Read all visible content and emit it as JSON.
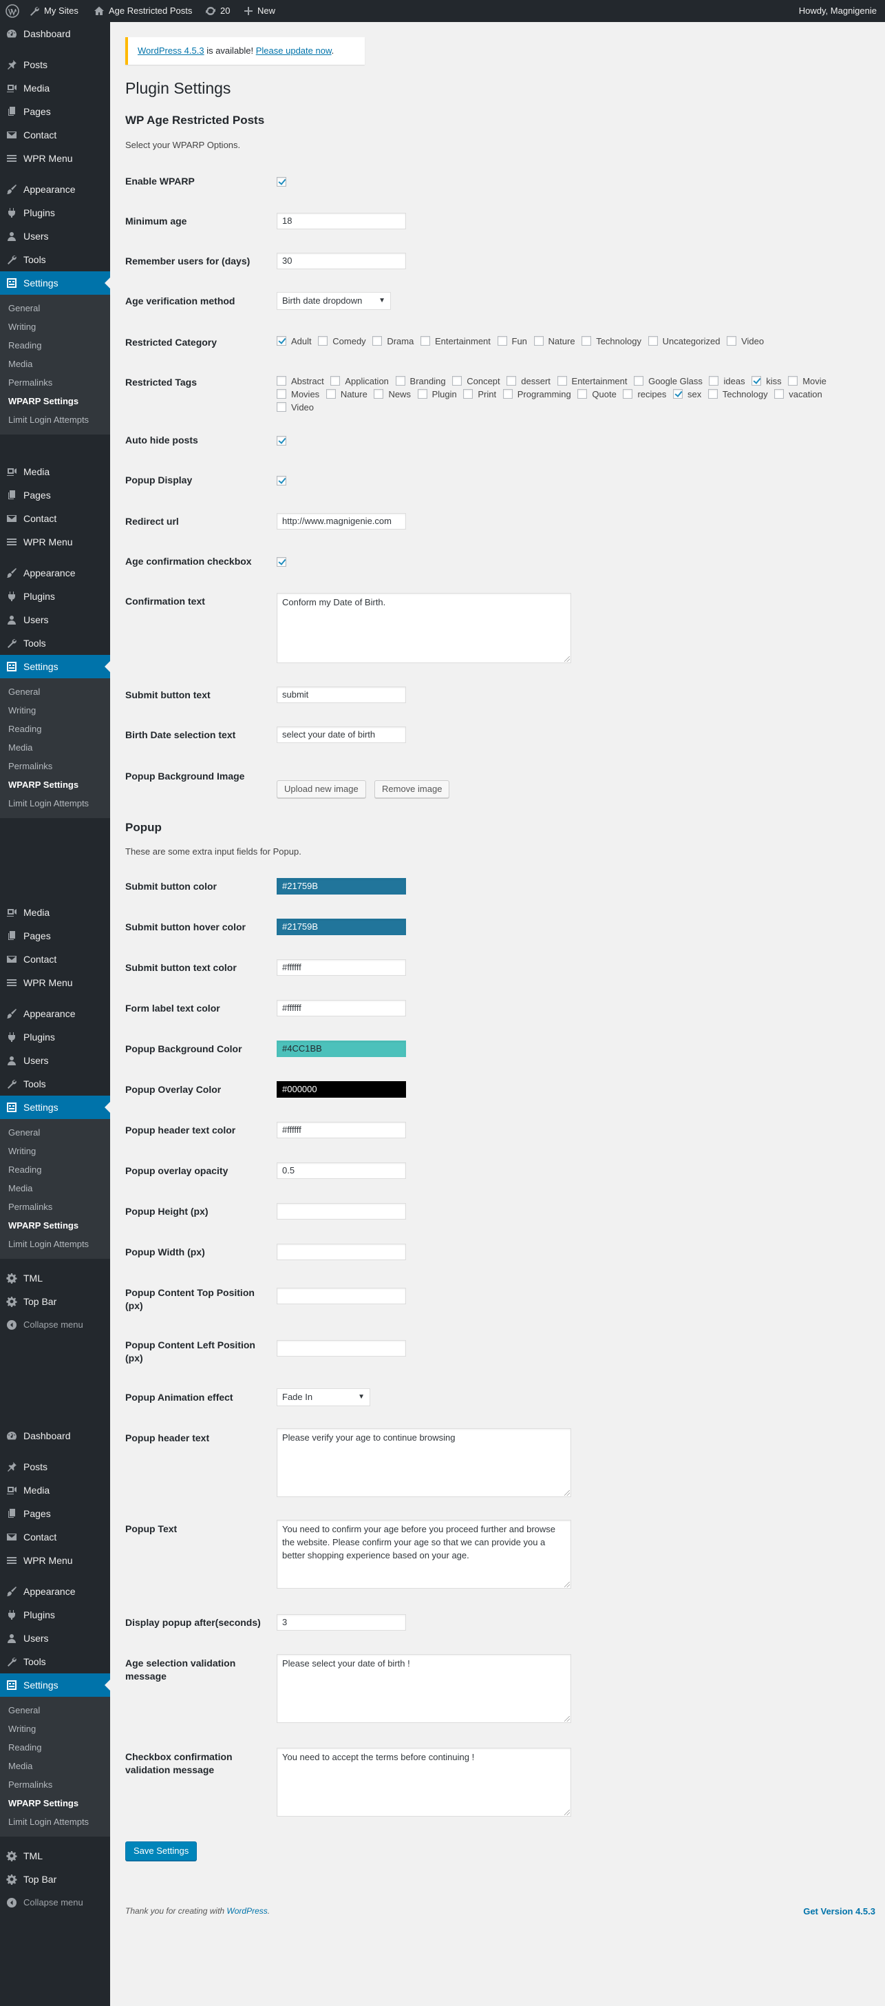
{
  "adminbar": {
    "my_sites": "My Sites",
    "site_name": "Age Restricted Posts",
    "updates_count": "20",
    "new_label": "New",
    "howdy": "Howdy, Magnigenie"
  },
  "sidebar": {
    "dashboard": "Dashboard",
    "posts": "Posts",
    "media": "Media",
    "pages": "Pages",
    "contact": "Contact",
    "wpr_menu": "WPR Menu",
    "appearance": "Appearance",
    "plugins": "Plugins",
    "users": "Users",
    "tools": "Tools",
    "settings": "Settings",
    "submenu": [
      "General",
      "Writing",
      "Reading",
      "Media",
      "Permalinks",
      "WPARP Settings",
      "Limit Login Attempts"
    ],
    "tml": "TML",
    "top_bar": "Top Bar",
    "collapse": "Collapse menu"
  },
  "notice": {
    "version_link": "WordPress 4.5.3",
    "middle": " is available! ",
    "update_link": "Please update now",
    "end": "."
  },
  "page": {
    "title": "Plugin Settings",
    "section_title": "WP Age Restricted Posts",
    "section_desc": "Select your WPARP Options.",
    "popup_title": "Popup",
    "popup_desc": "These are some extra input fields for Popup."
  },
  "fields": {
    "enable": {
      "label": "Enable WPARP",
      "checked": true
    },
    "min_age": {
      "label": "Minimum age",
      "value": "18"
    },
    "remember": {
      "label": "Remember users for (days)",
      "value": "30"
    },
    "verify_method": {
      "label": "Age verification method",
      "value": "Birth date dropdown"
    },
    "restricted_category": {
      "label": "Restricted Category"
    },
    "restricted_tags": {
      "label": "Restricted Tags"
    },
    "auto_hide": {
      "label": "Auto hide posts",
      "checked": true
    },
    "popup_display": {
      "label": "Popup Display",
      "checked": true
    },
    "redirect_url": {
      "label": "Redirect url",
      "value": "http://www.magnigenie.com"
    },
    "age_confirm_checkbox": {
      "label": "Age confirmation checkbox",
      "checked": true
    },
    "confirmation_text": {
      "label": "Confirmation text",
      "value": "Conform my Date of Birth."
    },
    "submit_text": {
      "label": "Submit button text",
      "value": "submit"
    },
    "birth_date_text": {
      "label": "Birth Date selection text",
      "value": "select your date of birth"
    },
    "bg_image": {
      "label": "Popup Background Image",
      "upload": "Upload new image",
      "remove": "Remove image"
    },
    "submit_color": {
      "label": "Submit button color",
      "value": "#21759B"
    },
    "submit_hover": {
      "label": "Submit button hover color",
      "value": "#21759B"
    },
    "submit_text_color": {
      "label": "Submit button text color",
      "value": "#ffffff"
    },
    "form_label_color": {
      "label": "Form label text color",
      "value": "#ffffff"
    },
    "popup_bg_color": {
      "label": "Popup Background Color",
      "value": "#4CC1BB"
    },
    "overlay_color": {
      "label": "Popup Overlay Color",
      "value": "#000000"
    },
    "header_text_color": {
      "label": "Popup header text color",
      "value": "#ffffff"
    },
    "overlay_opacity": {
      "label": "Popup overlay opacity",
      "value": "0.5"
    },
    "popup_height": {
      "label": "Popup Height (px)",
      "value": ""
    },
    "popup_width": {
      "label": "Popup Width (px)",
      "value": ""
    },
    "content_top": {
      "label": "Popup Content Top Position (px)",
      "value": ""
    },
    "content_left": {
      "label": "Popup Content Left Position (px)",
      "value": ""
    },
    "animation": {
      "label": "Popup Animation effect",
      "value": "Fade In"
    },
    "header_text": {
      "label": "Popup header text",
      "value": "Please verify your age to continue browsing"
    },
    "popup_text": {
      "label": "Popup Text",
      "value": "You need to confirm your age before you proceed further and browse the website. Please confirm your age so that we can provide you a better shopping experience based on your age."
    },
    "display_after": {
      "label": "Display popup after(seconds)",
      "value": "3"
    },
    "age_validation": {
      "label": "Age selection validation message",
      "value": "Please select your date of birth !"
    },
    "checkbox_validation": {
      "label": "Checkbox confirmation validation message",
      "value": "You need to accept the terms before continuing !"
    }
  },
  "categories": [
    {
      "label": "Adult",
      "checked": true
    },
    {
      "label": "Comedy",
      "checked": false
    },
    {
      "label": "Drama",
      "checked": false
    },
    {
      "label": "Entertainment",
      "checked": false
    },
    {
      "label": "Fun",
      "checked": false
    },
    {
      "label": "Nature",
      "checked": false
    },
    {
      "label": "Technology",
      "checked": false
    },
    {
      "label": "Uncategorized",
      "checked": false
    },
    {
      "label": "Video",
      "checked": false
    }
  ],
  "tags": [
    {
      "label": "Abstract",
      "checked": false
    },
    {
      "label": "Application",
      "checked": false
    },
    {
      "label": "Branding",
      "checked": false
    },
    {
      "label": "Concept",
      "checked": false
    },
    {
      "label": "dessert",
      "checked": false
    },
    {
      "label": "Entertainment",
      "checked": false
    },
    {
      "label": "Google Glass",
      "checked": false
    },
    {
      "label": "ideas",
      "checked": false
    },
    {
      "label": "kiss",
      "checked": true
    },
    {
      "label": "Movie",
      "checked": false
    },
    {
      "label": "Movies",
      "checked": false
    },
    {
      "label": "Nature",
      "checked": false
    },
    {
      "label": "News",
      "checked": false
    },
    {
      "label": "Plugin",
      "checked": false
    },
    {
      "label": "Print",
      "checked": false
    },
    {
      "label": "Programming",
      "checked": false
    },
    {
      "label": "Quote",
      "checked": false
    },
    {
      "label": "recipes",
      "checked": false
    },
    {
      "label": "sex",
      "checked": true
    },
    {
      "label": "Technology",
      "checked": false
    },
    {
      "label": "vacation",
      "checked": false
    },
    {
      "label": "Video",
      "checked": false
    }
  ],
  "actions": {
    "save": "Save Settings"
  },
  "footer": {
    "thanks": "Thank you for creating with ",
    "wp_link": "WordPress",
    "end": ".",
    "version": "Get Version 4.5.3"
  },
  "colors": {
    "admin_bar": "#23282d",
    "sidebar": "#23282d",
    "active": "#0073aa",
    "submit_swatch": "#21759B",
    "popup_bg_swatch": "#4CC1BB",
    "overlay_swatch": "#000000"
  }
}
